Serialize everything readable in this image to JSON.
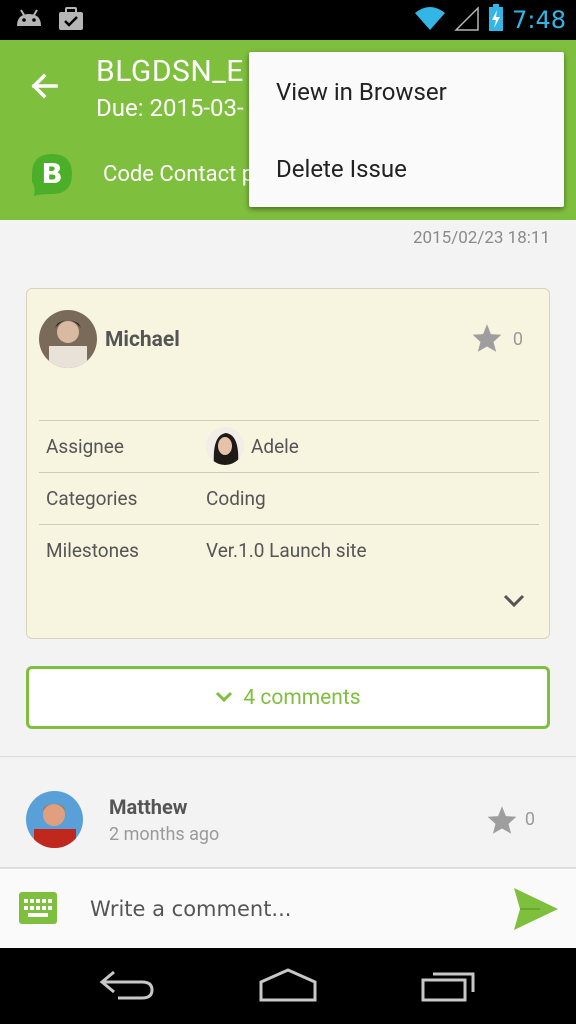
{
  "status_bar": {
    "time": "7:48",
    "icons": [
      "android-icon",
      "briefcase-icon",
      "wifi-icon",
      "signal-icon",
      "battery-charging-icon"
    ]
  },
  "app_bar": {
    "title": "BLGDSN_E",
    "due": "Due: 2015-03-",
    "project_name": "Code Contact p",
    "colors": {
      "primary": "#7fbf3e",
      "text": "#ffffff"
    }
  },
  "overflow_menu": {
    "items": [
      {
        "label": "View in Browser"
      },
      {
        "label": "Delete Issue"
      }
    ]
  },
  "issue": {
    "created_at": "2015/02/23 18:11",
    "author": "Michael",
    "star_count": "0",
    "fields": {
      "assignee": {
        "label": "Assignee",
        "value": "Adele"
      },
      "categories": {
        "label": "Categories",
        "value": "Coding"
      },
      "milestones": {
        "label": "Milestones",
        "value": "Ver.1.0 Launch site"
      }
    }
  },
  "comments_toggle": {
    "label": "4 comments"
  },
  "comment": {
    "author": "Matthew",
    "time": "2 months ago",
    "star_count": "0"
  },
  "input_bar": {
    "placeholder": "Write a comment..."
  }
}
